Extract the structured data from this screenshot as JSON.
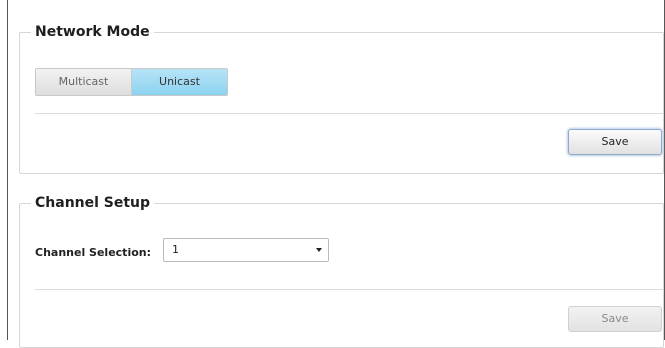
{
  "network_mode": {
    "title": "Network Mode",
    "options": [
      {
        "label": "Multicast",
        "selected": false
      },
      {
        "label": "Unicast",
        "selected": true
      }
    ],
    "save_label": "Save",
    "active_color": "#8cd2ef"
  },
  "channel_setup": {
    "title": "Channel Setup",
    "channel_label": "Channel Selection:",
    "channel_value": "1",
    "save_label": "Save",
    "save_enabled": false
  }
}
